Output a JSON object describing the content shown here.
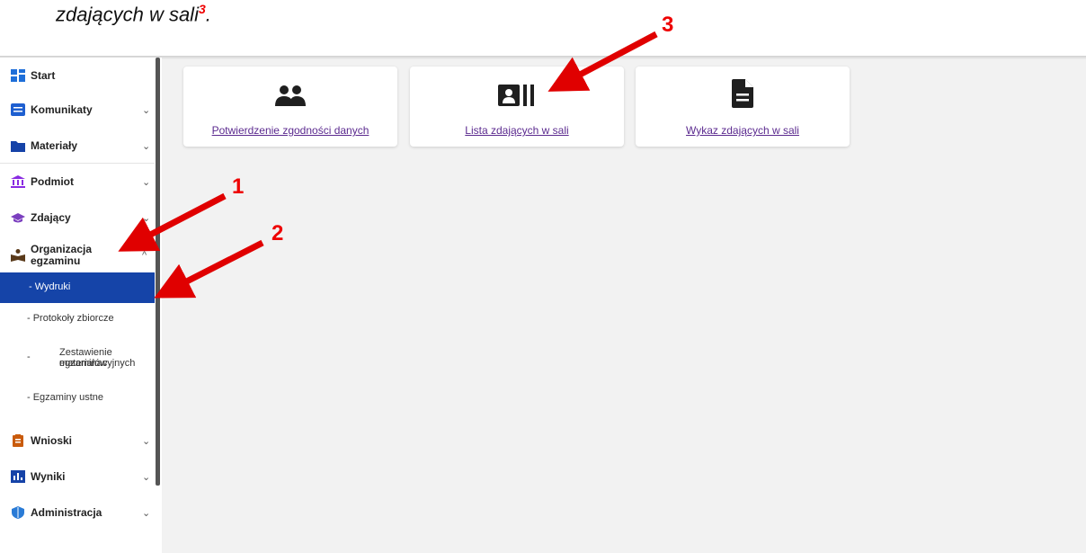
{
  "caption": {
    "text": "zdających w sali",
    "footnote": "3",
    "tail": "."
  },
  "sidebar": {
    "items": [
      {
        "label": "Start"
      },
      {
        "label": "Komunikaty",
        "chevron": "⌄"
      },
      {
        "label": "Materiały",
        "chevron": "⌄"
      },
      {
        "label": "Podmiot",
        "chevron": "⌄"
      },
      {
        "label": "Zdający",
        "chevron": "⌄"
      },
      {
        "label": "Organizacja",
        "label2": "egzaminu",
        "chevron": "^"
      },
      {
        "label": "Wnioski",
        "chevron": "⌄"
      },
      {
        "label": "Wyniki",
        "chevron": "⌄"
      },
      {
        "label": "Administracja",
        "chevron": "⌄"
      }
    ],
    "subitems": [
      {
        "label": "- Wydruki"
      },
      {
        "label": "- Protokoły zbiorcze"
      },
      {
        "label": "Zestawienie materiałów",
        "label2": "egzaminacyjnych",
        "prefix": "-"
      },
      {
        "label": "- Egzaminy ustne"
      }
    ]
  },
  "cards": [
    {
      "label": "Potwierdzenie zgodności danych",
      "icon": "people-icon"
    },
    {
      "label": "Lista zdających w sali",
      "icon": "id-list-icon"
    },
    {
      "label": "Wykaz zdających w sali",
      "icon": "document-icon"
    }
  ],
  "annotations": {
    "n1": "1",
    "n2": "2",
    "n3": "3"
  },
  "colors": {
    "active": "#1544a8",
    "arrow": "#e00000",
    "link": "#5b2a8f"
  }
}
